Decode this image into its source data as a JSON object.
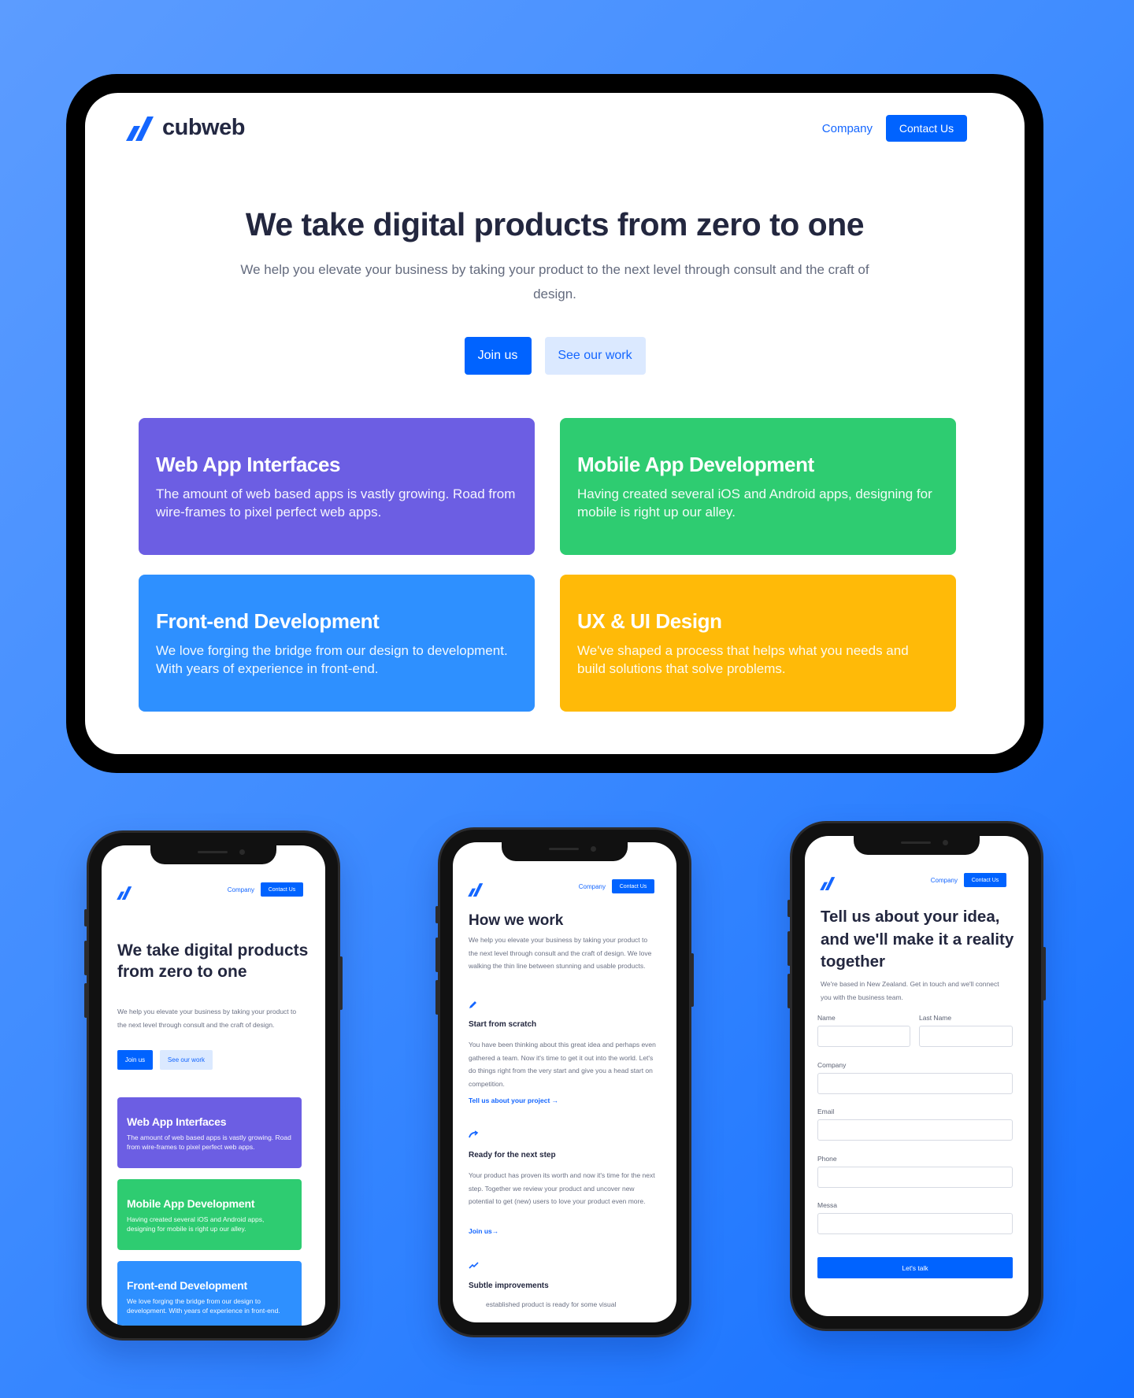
{
  "brand": {
    "name": "cubweb",
    "logo_icon": "cubweb-logo-icon",
    "accent": "#0063ff"
  },
  "nav": {
    "company": "Company",
    "contact": "Contact Us"
  },
  "hero": {
    "title": "We take digital products from zero to one",
    "subtitle": "We help you elevate your business by taking your product to the next level through consult and the craft of design.",
    "subtitle_mobile": "We help you elevate your business by taking your product to the next level through consult and the craft of design.",
    "join": "Join us",
    "see_work": "See our work"
  },
  "services": [
    {
      "title": "Web App Interfaces",
      "text": "The amount of web based apps is vastly growing. Road from wire-frames to pixel perfect web apps.",
      "color": "#6c5ee3"
    },
    {
      "title": "Mobile App Development",
      "text": "Having created several iOS and Android apps, designing for mobile is right up our alley.",
      "color": "#2ecc71"
    },
    {
      "title": "Front-end Development",
      "text": "We love forging the bridge from our design to development. With years of experience in front-end.",
      "color": "#2e90ff"
    },
    {
      "title": "UX & UI Design",
      "text": "We've shaped a process that helps what you needs and build solutions that solve problems.",
      "color": "#ffba08"
    }
  ],
  "how": {
    "title": "How we work",
    "intro": "We help you elevate your business by taking your product to the next level through consult and the craft of design. We love walking the thin line between stunning and usable products.",
    "steps": [
      {
        "icon": "pencil-icon",
        "title": "Start from scratch",
        "text": "You have been thinking about this great idea and perhaps even gathered a team. Now it's time to get it out into the world. Let's do things right from the very start and give you a head start on competition.",
        "link": "Tell us about your project →"
      },
      {
        "icon": "redo-arrow-icon",
        "title": "Ready for the next step",
        "text": "Your product has proven its worth and now it's time for the next step. Together we review your product and uncover new potential to get (new) users to love your product even more.",
        "link": "Join us→"
      },
      {
        "icon": "trend-icon",
        "title": "Subtle improvements",
        "text": "established product is ready for some visual"
      }
    ]
  },
  "contact": {
    "title": "Tell us about your idea, and we'll make it a reality together",
    "intro": "We're based in New Zealand. Get in touch and we'll connect you with the business team.",
    "fields": {
      "name": "Name",
      "last_name": "Last Name",
      "company": "Company",
      "email": "Email",
      "phone": "Phone",
      "message": "Messa"
    },
    "submit": "Let's talk"
  }
}
